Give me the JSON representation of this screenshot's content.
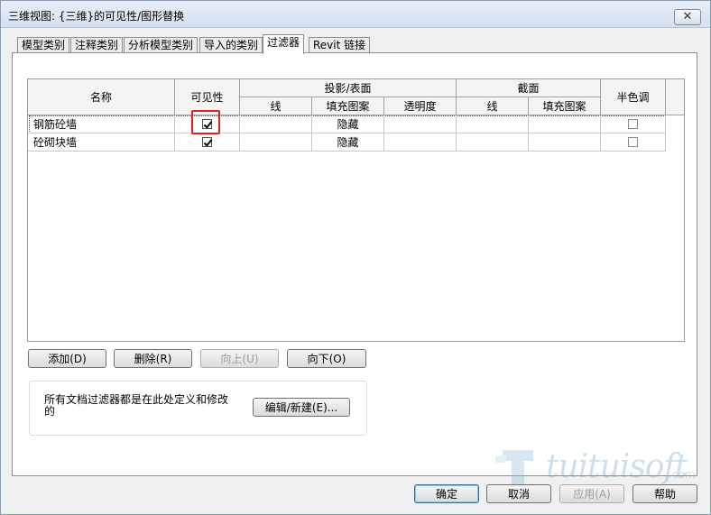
{
  "window": {
    "title": "三维视图: {三维}的可见性/图形替换",
    "close_glyph": "✕"
  },
  "tabs": [
    {
      "label": "模型类别"
    },
    {
      "label": "注释类别"
    },
    {
      "label": "分析模型类别"
    },
    {
      "label": "导入的类别"
    },
    {
      "label": "过滤器",
      "active": true
    },
    {
      "label": "Revit 链接"
    }
  ],
  "grid": {
    "headers": {
      "name": "名称",
      "visibility": "可见性",
      "projection_surface": "投影/表面",
      "proj_line": "线",
      "proj_fill": "填充图案",
      "proj_transparency": "透明度",
      "cut": "截面",
      "cut_line": "线",
      "cut_fill": "填充图案",
      "halftone": "半色调"
    },
    "rows": [
      {
        "name": "钢筋砼墙",
        "visible": true,
        "proj_line": "",
        "proj_fill": "隐藏",
        "proj_transparency": "",
        "cut_line": "",
        "cut_fill": "",
        "halftone": false
      },
      {
        "name": "砼砌块墙",
        "visible": true,
        "proj_line": "",
        "proj_fill": "隐藏",
        "proj_transparency": "",
        "cut_line": "",
        "cut_fill": "",
        "halftone": false
      }
    ]
  },
  "filter_buttons": {
    "add": "添加(D)",
    "delete": "删除(R)",
    "up": "向上(U)",
    "down": "向下(O)"
  },
  "info": {
    "text": "所有文档过滤器都是在此处定义和修改的",
    "edit_button": "编辑/新建(E)..."
  },
  "footer": {
    "ok": "确定",
    "cancel": "取消",
    "apply": "应用(A)",
    "help": "帮助"
  },
  "watermark": {
    "text": "tuituisoft",
    "suffix": ".com"
  },
  "colors": {
    "highlight": "#e01f1f",
    "default_button_border": "#2d6fa8"
  }
}
